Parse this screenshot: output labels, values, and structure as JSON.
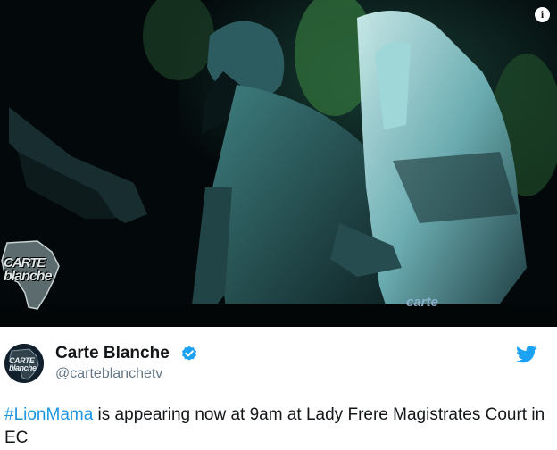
{
  "media": {
    "info_icon_label": "i",
    "watermark_line1": "CARTE",
    "watermark_line2": "blanche",
    "caption_mark": "carte"
  },
  "tweet": {
    "display_name": "Carte Blanche",
    "handle": "@carteblanchetv",
    "hashtag": "#LionMama",
    "text_rest": " is appearing now at 9am at Lady Frere Magistrates Court in EC",
    "avatar_line1": "CARTE",
    "avatar_line2": "blanche"
  },
  "icons": {
    "info": "info-icon",
    "verified": "verified-badge-icon",
    "twitter": "twitter-bird-icon"
  },
  "colors": {
    "link": "#1b95e0",
    "handle": "#657786",
    "text": "#14171a",
    "twitter_blue": "#1da1f2"
  }
}
